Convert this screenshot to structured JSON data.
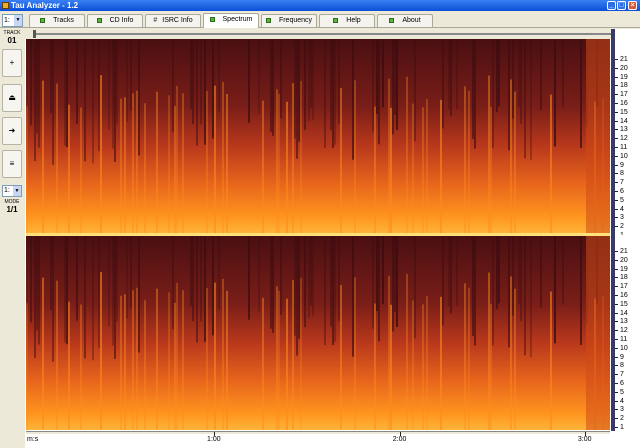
{
  "window": {
    "title": "Tau Analyzer - 1.2"
  },
  "colors": {
    "spec_low": "#5a1414",
    "spec_mid": "#c0361a",
    "spec_high": "#ff9a1e",
    "divider": "#ffe07a"
  },
  "tabs": [
    {
      "label": "Tracks",
      "marker": "led"
    },
    {
      "label": "CD Info",
      "marker": "led"
    },
    {
      "label": "ISRC Info",
      "marker": "#"
    },
    {
      "label": "Spectrum",
      "marker": "led",
      "active": true
    },
    {
      "label": "Frequency",
      "marker": "led"
    },
    {
      "label": "Help",
      "marker": "led"
    },
    {
      "label": "About",
      "marker": "led"
    }
  ],
  "sidebar": {
    "track_select": "1:",
    "track_label": "TRACK",
    "track_number": "01",
    "buttons": [
      {
        "name": "add",
        "glyph": "+"
      },
      {
        "name": "eject",
        "glyph": "⏏"
      },
      {
        "name": "next",
        "glyph": "➜"
      },
      {
        "name": "list",
        "glyph": "≡"
      }
    ],
    "mode_select": "1:",
    "mode_label": "MODE",
    "mode_value": "1/1"
  },
  "freq_axis": {
    "unit": "kHz",
    "labels": [
      "21",
      "20",
      "19",
      "18",
      "17",
      "16",
      "15",
      "14",
      "13",
      "12",
      "11",
      "10",
      "9",
      "8",
      "7",
      "6",
      "5",
      "4",
      "3",
      "2",
      "1"
    ]
  },
  "time_axis": {
    "unit_label": "m:s",
    "labels": [
      "1:00",
      "2:00",
      "3:00"
    ],
    "positions": [
      0.322,
      0.64,
      0.957
    ]
  }
}
